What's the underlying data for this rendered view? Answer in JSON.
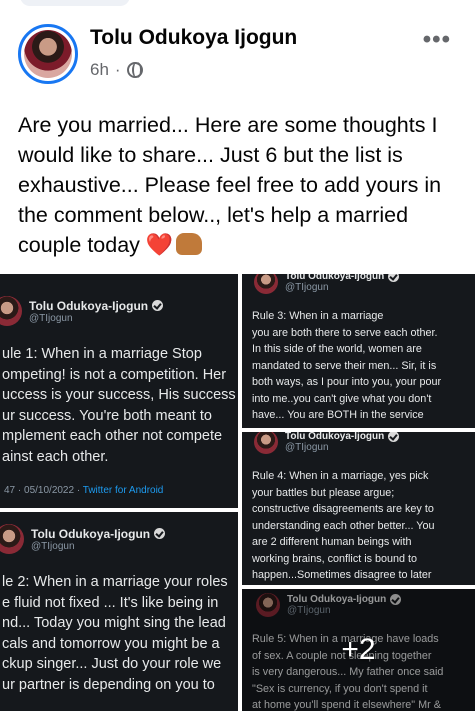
{
  "post": {
    "author": "Tolu Odukoya Ijogun",
    "time": "6h",
    "separator": "·",
    "more_label": "•••",
    "caption": "Are you married... Here are some thoughts I would like to share... Just 6 but the list is exhaustive... Please feel free to add yours in the comment below.., let's help a married couple today",
    "caption_emoji_1": "❤️",
    "icons": {
      "globe": "globe-icon",
      "more": "more-options-icon",
      "heart": "red-heart-emoji",
      "fist": "fist-bump-emoji"
    }
  },
  "media": {
    "more_count": "+2",
    "tiles": [
      {
        "name": "Tolu Odukoya-Ijogun",
        "handle": "@TIjogun",
        "text": "ule 1: When in a marriage Stop\nompeting! is not a competition. Her\nuccess is your success, His success\nur success. You're both meant to\nmplement each other not compete\nainst each other.",
        "footer_time": "47 · 05/10/2022 ·",
        "footer_source": "Twitter for Android"
      },
      {
        "name": "Tolu Odukoya-Ijogun",
        "handle": "@TIjogun",
        "text": "le 2: When in a marriage your roles\ne fluid not fixed ... It's like being in\nnd... Today you might sing the lead\ncals and tomorrow you might be a\nckup singer... Just do your role we\nur partner is depending on you to"
      },
      {
        "name": "Tolu Odukoya-Ijogun",
        "handle": "@TIjogun",
        "text": "Rule 3: When in a marriage\nyou are both there to serve each other.\nIn this side of the world, women are\nmandated to serve their men... Sir, it is\nboth ways, as I pour into you, your pour\ninto me..you can't give what you don't\nhave... You are BOTH in the service"
      },
      {
        "name": "Tolu Odukoya-Ijogun",
        "handle": "@TIjogun",
        "text": "Rule 4: When in a marriage, yes pick\nyour battles but please argue;\nconstructive disagreements are key to\nunderstanding each other better... You\nare 2 different human beings with\nworking brains, conflict is bound to\nhappen...Sometimes disagree to later"
      },
      {
        "name": "Tolu Odukoya-Ijogun",
        "handle": "@TIjogun",
        "text": "Rule 5: When in a marriage have loads\nof sex. A couple not sleeping together\nis very dangerous... My father once said\n\"Sex is currency, if you don't spend it\nat home you'll spend it elsewhere\" Mr &"
      }
    ]
  }
}
